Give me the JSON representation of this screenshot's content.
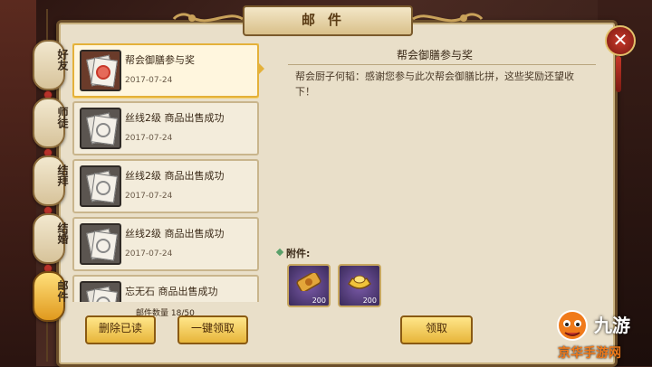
{
  "window": {
    "title": "邮件",
    "close_icon": "close-icon"
  },
  "tabs": [
    {
      "label": "好友",
      "active": false
    },
    {
      "label": "师徒",
      "active": false
    },
    {
      "label": "结拜",
      "active": false
    },
    {
      "label": "结婚",
      "active": false
    },
    {
      "label": "邮件",
      "active": true
    }
  ],
  "mails": [
    {
      "subject": "帮会御膳参与奖",
      "date": "2017-07-24",
      "selected": true
    },
    {
      "subject": "丝线2级 商品出售成功",
      "date": "2017-07-24",
      "selected": false
    },
    {
      "subject": "丝线2级 商品出售成功",
      "date": "2017-07-24",
      "selected": false
    },
    {
      "subject": "丝线2级 商品出售成功",
      "date": "2017-07-24",
      "selected": false
    },
    {
      "subject": "忘无石 商品出售成功",
      "date": "",
      "selected": false
    }
  ],
  "mail_count": "邮件数量 18/50",
  "buttons": {
    "delete_read": "删除已读",
    "claim_all": "一键领取",
    "claim": "领取"
  },
  "detail": {
    "title": "帮会御膳参与奖",
    "body": "帮会厨子何韬：感谢您参与此次帮会御膳比拼，这些奖励还望收下！",
    "attachments_label": "附件:",
    "attachments": [
      {
        "icon": "ticket-icon",
        "count": "200"
      },
      {
        "icon": "gold-ingot-icon",
        "count": "200"
      }
    ]
  },
  "watermark": {
    "brand": "九游",
    "site": "京华手游网"
  }
}
